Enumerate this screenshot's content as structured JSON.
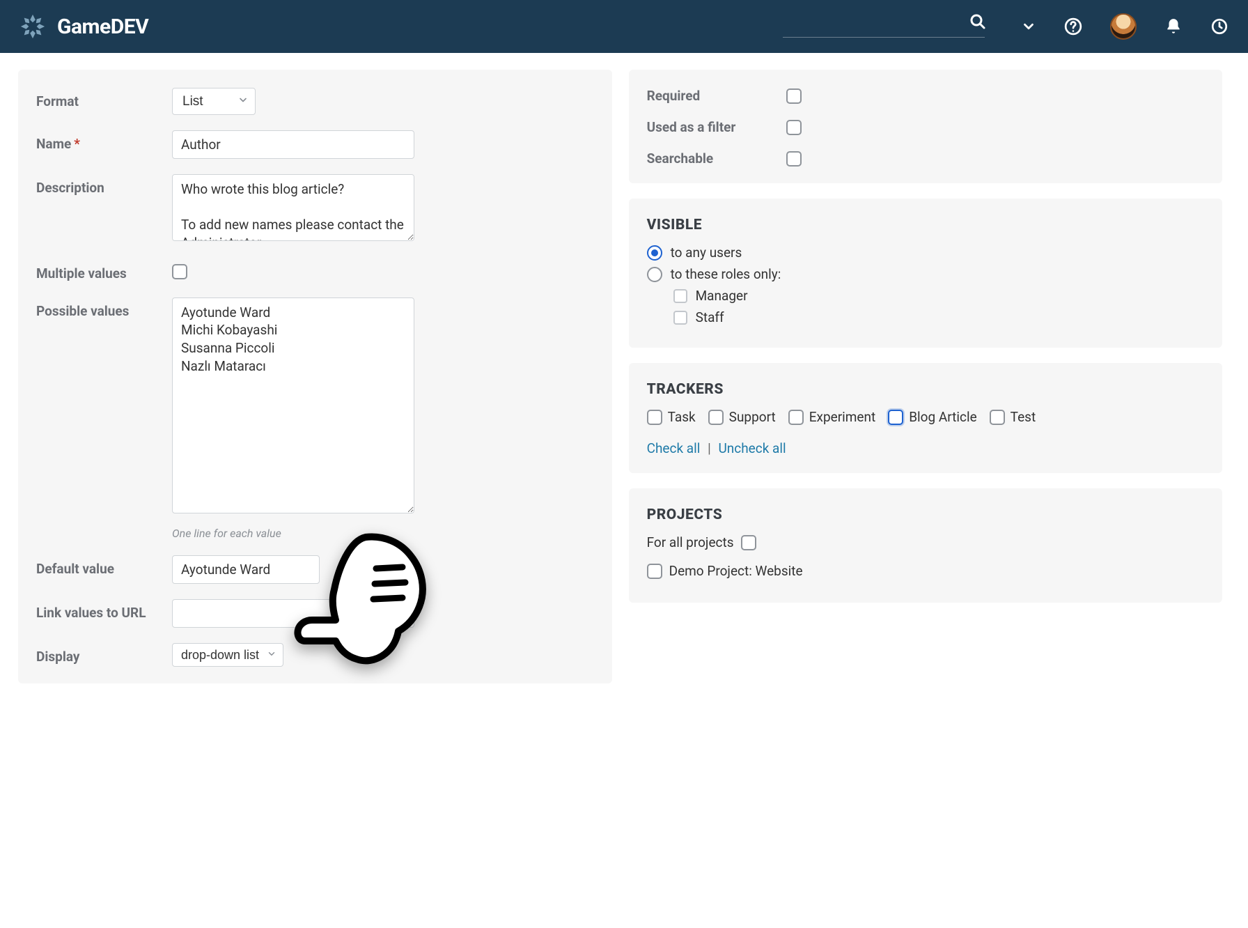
{
  "header": {
    "brand": "GameDEV"
  },
  "left": {
    "format": {
      "label": "Format",
      "value": "List"
    },
    "name": {
      "label": "Name",
      "required_mark": "*",
      "value": "Author"
    },
    "description": {
      "label": "Description",
      "value": "Who wrote this blog article?\n\nTo add new names please contact the Administrator."
    },
    "multiple_values": {
      "label": "Multiple values",
      "checked": false
    },
    "possible_values": {
      "label": "Possible values",
      "value": "Ayotunde Ward\nMichi Kobayashi\nSusanna Piccoli\nNazlı Mataracı",
      "hint": "One line for each value"
    },
    "default_value": {
      "label": "Default value",
      "value": "Ayotunde Ward"
    },
    "link_values_to_url": {
      "label": "Link values to URL",
      "value": ""
    },
    "display": {
      "label": "Display",
      "value": "drop-down list"
    }
  },
  "right": {
    "flags": {
      "required": {
        "label": "Required",
        "checked": false
      },
      "used_as_filter": {
        "label": "Used as a filter",
        "checked": false
      },
      "searchable": {
        "label": "Searchable",
        "checked": false
      }
    },
    "visible": {
      "title": "VISIBLE",
      "any_users": "to any users",
      "roles_only": "to these roles only:",
      "selected": "any",
      "roles": [
        {
          "label": "Manager",
          "checked": false
        },
        {
          "label": "Staff",
          "checked": false
        }
      ]
    },
    "trackers": {
      "title": "TRACKERS",
      "items": [
        {
          "label": "Task",
          "checked": false,
          "highlight": false
        },
        {
          "label": "Support",
          "checked": false,
          "highlight": false
        },
        {
          "label": "Experiment",
          "checked": false,
          "highlight": false
        },
        {
          "label": "Blog Article",
          "checked": false,
          "highlight": true
        },
        {
          "label": "Test",
          "checked": false,
          "highlight": false
        }
      ],
      "check_all": "Check all",
      "uncheck_all": "Uncheck all"
    },
    "projects": {
      "title": "PROJECTS",
      "for_all_label": "For all projects",
      "for_all_checked": false,
      "items": [
        {
          "label": "Demo Project: Website",
          "checked": false
        }
      ]
    }
  }
}
